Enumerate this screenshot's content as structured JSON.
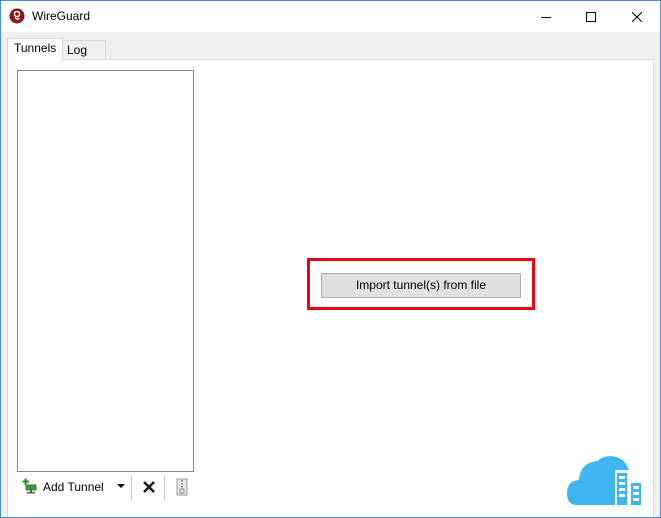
{
  "window": {
    "title": "WireGuard",
    "icon": "wireguard-logo-icon",
    "controls": [
      "minimize-icon",
      "maximize-icon",
      "close-icon"
    ]
  },
  "tabs": [
    {
      "label": "Tunnels",
      "selected": true
    },
    {
      "label": "Log",
      "selected": false
    }
  ],
  "toolbar": {
    "add_tunnel_label": "Add Tunnel",
    "add_icon": "add-tunnel-icon",
    "dropdown_icon": "dropdown-arrow-icon",
    "delete_icon": "delete-x-icon",
    "export_icon": "export-zip-icon"
  },
  "main": {
    "import_button_label": "Import tunnel(s) from file",
    "highlight_color": "#e30613"
  },
  "colors": {
    "accent": "#4a8fd9",
    "cloud_logo": "#3fb6f2",
    "wireguard_red": "#88171a"
  }
}
